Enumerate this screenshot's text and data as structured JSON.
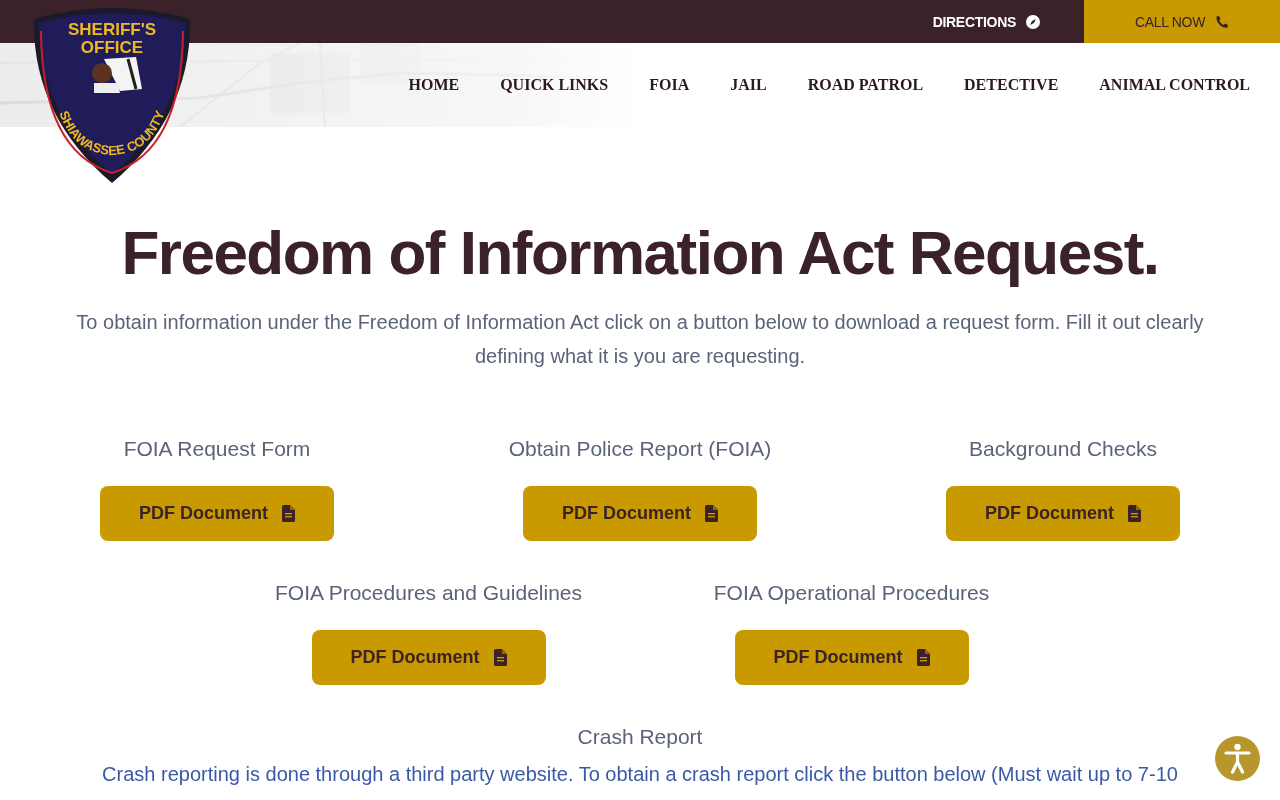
{
  "top_bar": {
    "directions": "DIRECTIONS",
    "call_now": "CALL NOW"
  },
  "logo": {
    "top_lines": [
      "SHERIFF'S",
      "OFFICE"
    ],
    "county": "SHIAWASSEE COUNTY"
  },
  "nav": [
    {
      "label": "HOME"
    },
    {
      "label": "QUICK LINKS"
    },
    {
      "label": "FOIA"
    },
    {
      "label": "JAIL"
    },
    {
      "label": "ROAD PATROL"
    },
    {
      "label": "DETECTIVE"
    },
    {
      "label": "ANIMAL CONTROL"
    }
  ],
  "title": "Freedom of Information Act Request.",
  "intro": "To obtain information under the Freedom of Information Act click on a button below to download a request form. Fill it out clearly defining what it is you are requesting.",
  "document_rows": [
    {
      "items": [
        {
          "title": "FOIA Request Form",
          "button": "PDF Document"
        },
        {
          "title": "Obtain Police Report (FOIA)",
          "button": "PDF Document"
        },
        {
          "title": "Background Checks",
          "button": "PDF Document"
        }
      ]
    },
    {
      "items": [
        {
          "title": "FOIA Procedures and Guidelines",
          "button": "PDF Document"
        },
        {
          "title": "FOIA Operational Procedures",
          "button": "PDF Document"
        }
      ]
    }
  ],
  "crash": {
    "title": "Crash Report",
    "text": "Crash reporting is done through a third party website. To obtain a crash report click the button below (Must wait up to 7-10"
  }
}
